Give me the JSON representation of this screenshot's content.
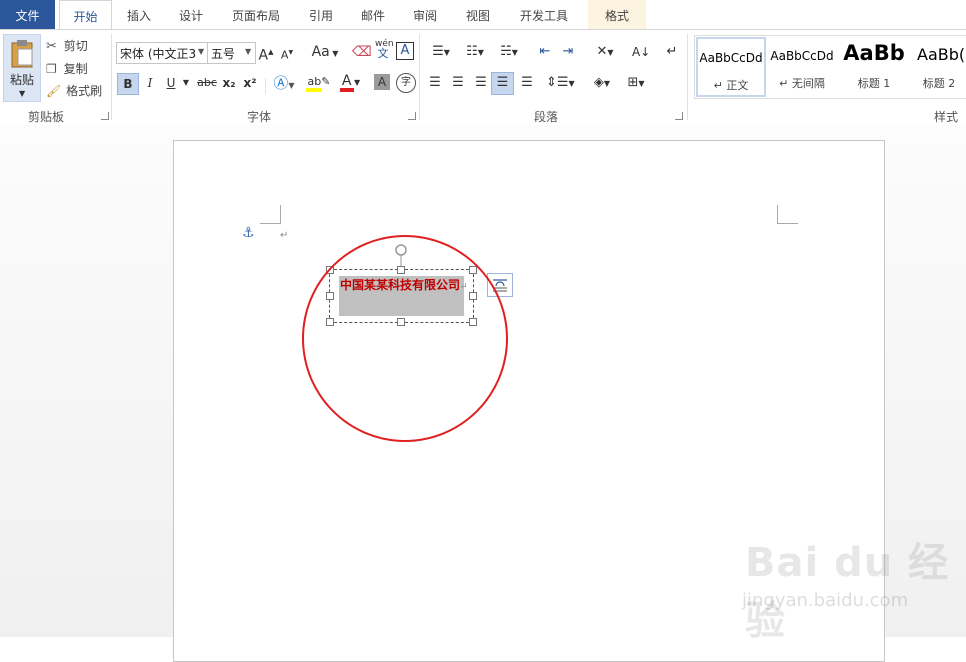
{
  "tabs": {
    "file": "文件",
    "home": "开始",
    "insert": "插入",
    "design": "设计",
    "layout": "页面布局",
    "references": "引用",
    "mailings": "邮件",
    "review": "审阅",
    "view": "视图",
    "developer": "开发工具",
    "format": "格式"
  },
  "clipboard": {
    "paste": "粘贴",
    "cut": "剪切",
    "copy": "复制",
    "format_painter": "格式刷",
    "group_label": "剪贴板"
  },
  "font": {
    "family": "宋体 (中文正文)",
    "family_display": "宋体 (中文正3",
    "size": "五号",
    "grow": "A",
    "shrink": "A",
    "case": "Aa",
    "bold": "B",
    "italic": "I",
    "underline": "U",
    "strike": "abc",
    "subscript": "x₂",
    "superscript": "x²",
    "phonetic": "wén",
    "group_label": "字体"
  },
  "paragraph": {
    "group_label": "段落"
  },
  "styles": {
    "group_label": "样式",
    "items": [
      {
        "preview": "AaBbCcDd",
        "name": "↵ 正文"
      },
      {
        "preview": "AaBbCcDd",
        "name": "↵ 无间隔"
      },
      {
        "preview": "AaBb",
        "name": "标题 1"
      },
      {
        "preview": "AaBb(",
        "name": "标题 2"
      }
    ]
  },
  "document": {
    "textbox_text": "中国某某科技有限公司",
    "paragraph_mark": "↵"
  },
  "watermark": {
    "logo": "Bai du 经验",
    "url": "jingyan.baidu.com"
  },
  "colors": {
    "accent": "#2b579a",
    "text_red": "#c00000",
    "circle": "#e02020"
  }
}
